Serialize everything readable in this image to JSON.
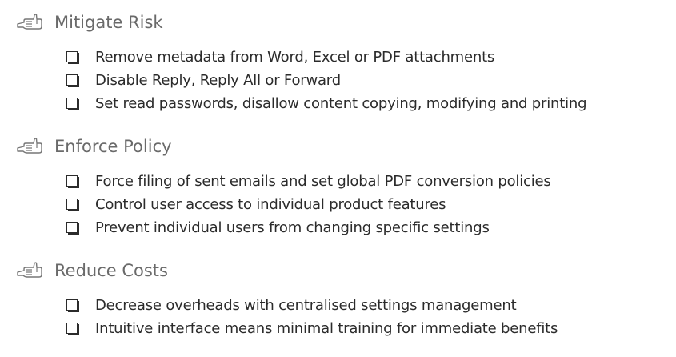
{
  "icons": {
    "heading_icon": "pointing-hand-icon",
    "item_icon": "checkbox-icon"
  },
  "colors": {
    "heading_text": "#6a6a6a",
    "item_text": "#2b2b2b"
  },
  "sections": [
    {
      "title": "Mitigate Risk",
      "items": [
        "Remove metadata from Word, Excel or PDF attachments",
        "Disable Reply, Reply All or Forward",
        "Set read passwords, disallow content copying, modifying and printing"
      ]
    },
    {
      "title": "Enforce Policy",
      "items": [
        "Force filing of sent emails and set global PDF conversion policies",
        "Control user access to individual product features",
        "Prevent individual users from changing specific settings"
      ]
    },
    {
      "title": "Reduce Costs",
      "items": [
        "Decrease overheads with centralised settings management",
        "Intuitive interface means minimal training for immediate benefits"
      ]
    }
  ]
}
